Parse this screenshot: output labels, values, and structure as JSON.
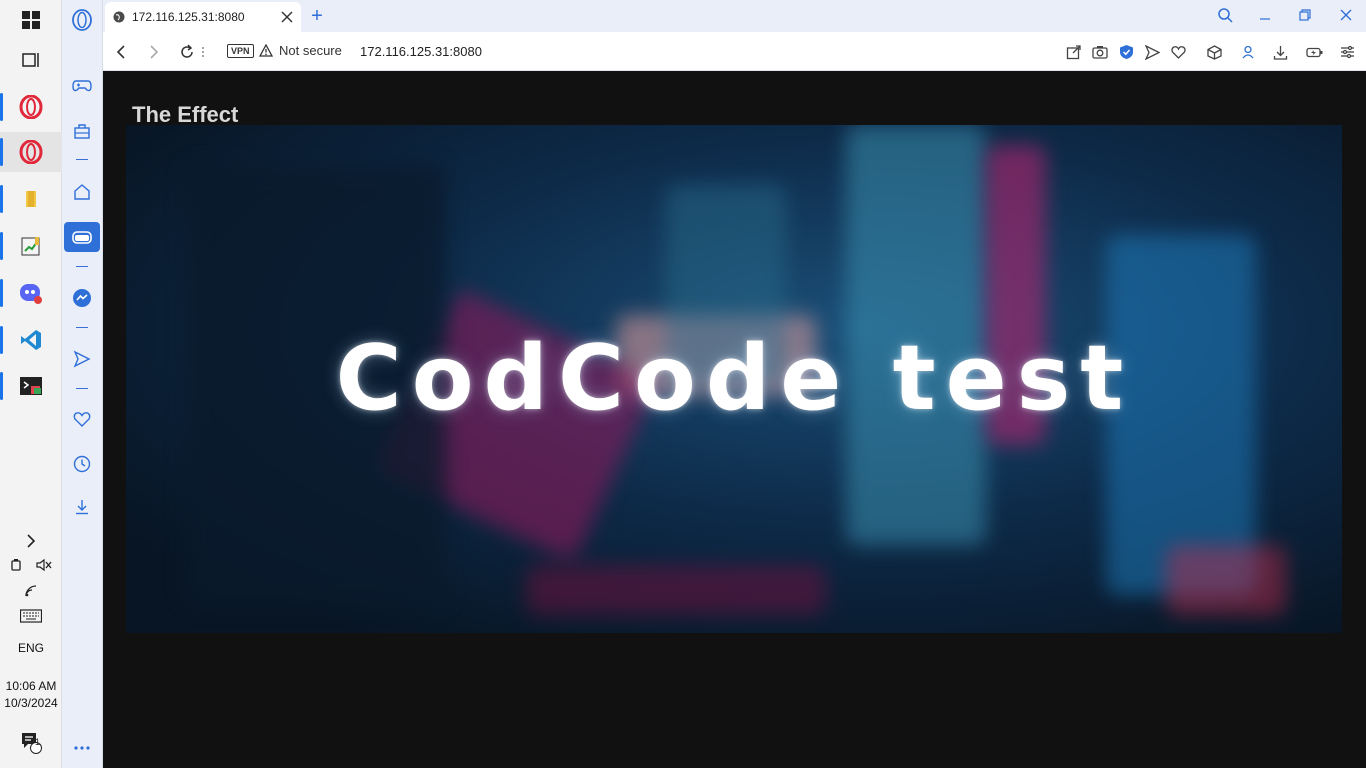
{
  "taskbar": {
    "items": [
      {
        "name": "start-button",
        "icon": "windows-logo-icon"
      },
      {
        "name": "task-view-button",
        "icon": "task-view-icon"
      },
      {
        "name": "opera-gx-app",
        "icon": "opera-icon"
      },
      {
        "name": "opera-app",
        "icon": "opera-icon"
      },
      {
        "name": "file-explorer-app",
        "icon": "folder-icon"
      },
      {
        "name": "notepad-app",
        "icon": "notepad-icon"
      },
      {
        "name": "discord-app",
        "icon": "discord-icon"
      },
      {
        "name": "vscode-app",
        "icon": "vscode-icon"
      },
      {
        "name": "terminal-app",
        "icon": "terminal-icon"
      }
    ],
    "tray": {
      "language": "ENG",
      "time": "10:06 AM",
      "date": "10/3/2024",
      "notification_count": "1"
    }
  },
  "sidebar": {
    "items": [
      "opera-logo",
      "gamepad",
      "shopping-bag",
      "home",
      "vr-headset",
      "messenger",
      "send",
      "heart",
      "history",
      "download",
      "more"
    ]
  },
  "browser": {
    "tab_title": "172.116.125.31:8080",
    "new_tab_label": "+",
    "vpn_label": "VPN",
    "security_text": "Not secure",
    "url": "172.116.125.31:8080",
    "accent_color": "#2f6fd8"
  },
  "page": {
    "heading": "The Effect",
    "hero_title": "CodCode test"
  }
}
